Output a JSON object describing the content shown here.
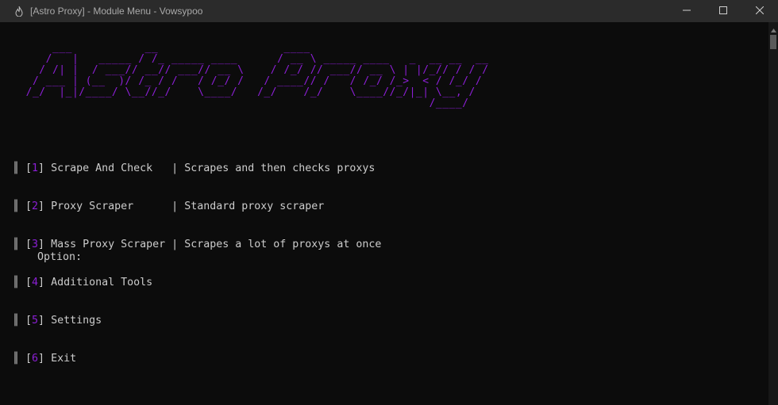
{
  "window": {
    "title": "[Astro Proxy] - Module Menu - Vowsypoo",
    "icon": "flame-icon",
    "controls": {
      "minimize_icon": "minimize-icon",
      "maximize_icon": "maximize-icon",
      "close_icon": "close-icon"
    }
  },
  "banner": {
    "text": "      ___           __                   ____                         \n     /   |   _____ / /_ _____ ____      / __ \\ _____ ____   _  __ __  __\n    / /| |  / ___// __// ___// __ \\    / /_/ // ___// __ \\ | |/_// / / /\n   / ___ | (__  )/ /_ / /   / /_/ /   / ____// /   / /_/ /_>  < / /_/ / \n  /_/  |_|/____/ \\__//_/    \\____/   /_/    /_/    \\____//_/|_| \\__, /  \n                                                               /____/   ",
    "color": "#8c1fd6"
  },
  "menu": {
    "items": [
      {
        "open": "[",
        "number": "1",
        "close": "]",
        "label": " Scrape And Check   ",
        "sep": "| ",
        "desc": "Scrapes and then checks proxys"
      },
      {
        "open": "[",
        "number": "2",
        "close": "]",
        "label": " Proxy Scraper      ",
        "sep": "| ",
        "desc": "Standard proxy scraper"
      },
      {
        "open": "[",
        "number": "3",
        "close": "]",
        "label": " Mass Proxy Scraper ",
        "sep": "| ",
        "desc": "Scrapes a lot of proxys at once"
      },
      {
        "open": "[",
        "number": "4",
        "close": "]",
        "label": " Additional Tools",
        "sep": "",
        "desc": ""
      },
      {
        "open": "[",
        "number": "5",
        "close": "]",
        "label": " Settings",
        "sep": "",
        "desc": ""
      },
      {
        "open": "[",
        "number": "6",
        "close": "]",
        "label": " Exit",
        "sep": "",
        "desc": ""
      }
    ],
    "bar_char": "║ ",
    "accent_color": "#8c1fd6",
    "text_color": "#cccccc"
  },
  "prompt": {
    "label": "Option:"
  },
  "colors": {
    "background": "#0c0c0c",
    "titlebar": "#2b2b2b"
  }
}
